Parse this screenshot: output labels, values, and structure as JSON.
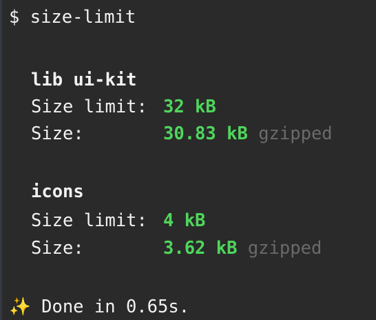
{
  "command": {
    "prompt": "$",
    "text": "size-limit"
  },
  "packages": [
    {
      "name": "lib ui-kit",
      "limit_label": "Size limit:",
      "limit": "32 kB",
      "size_label": "Size:",
      "size": "30.83 kB",
      "suffix": "gzipped"
    },
    {
      "name": "icons",
      "limit_label": "Size limit:",
      "limit": "4 kB",
      "size_label": "Size:",
      "size": "3.62 kB",
      "suffix": "gzipped"
    }
  ],
  "footer": {
    "icon": "✨",
    "text": "Done in 0.65s."
  },
  "colors": {
    "background": "#2a2a2a",
    "green": "#4fd65c",
    "muted": "#6a6a6a"
  }
}
